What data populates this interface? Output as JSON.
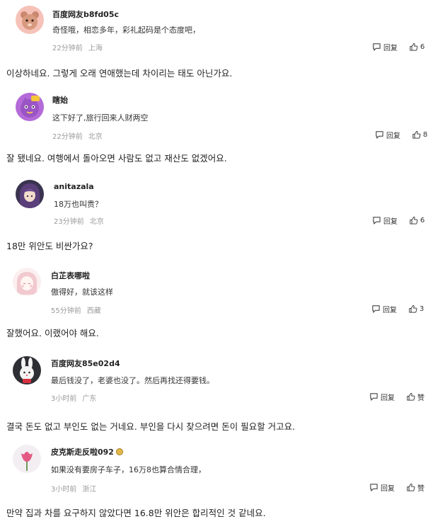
{
  "comments": [
    {
      "username": "百度网友b8fd05c",
      "text": "奇怪哦，相恋多年，彩礼起码是个态度吧，",
      "time": "22分钟前",
      "location": "上海",
      "reply_label": "回复",
      "like_count": "6",
      "avatar_icon": "cartoon-bear-avatar",
      "translation": "이상하네요. 그렇게 오래 연애했는데 차이리는 태도 아닌가요."
    },
    {
      "username": "瞎始",
      "text": "这下好了,旅行回来人财两空",
      "time": "22分钟前",
      "location": "北京",
      "reply_label": "回复",
      "like_count": "8",
      "avatar_icon": "purple-cat-avatar",
      "translation": "잘 됐네요. 여행에서 돌아오면 사람도 없고 재산도 없겠어요."
    },
    {
      "username": "anitazala",
      "text": "18万也叫贵？",
      "time": "23分钟前",
      "location": "北京",
      "reply_label": "回复",
      "like_count": "6",
      "avatar_icon": "anime-character-avatar",
      "translation": "18만 위안도 비싼가요?"
    },
    {
      "username": "白芷表哪啦",
      "text": "傲得好，就该这样",
      "time": "55分钟前",
      "location": "西藏",
      "reply_label": "回复",
      "like_count": "3",
      "avatar_icon": "pink-girl-avatar",
      "translation": "잘했어요. 이랬어야 해요."
    },
    {
      "username": "百度网友85e02d4",
      "text": "最后钱没了，老婆也没了。然后再找还得要钱。",
      "time": "3小时前",
      "location": "广东",
      "reply_label": "回复",
      "like_count": "赞",
      "avatar_icon": "white-rabbit-avatar",
      "translation": "결국 돈도 없고 부인도 없는 거네요. 부인을 다시 찾으려면 돈이 필요할 거고요."
    },
    {
      "username": "皮克斯走反啦092",
      "text": "如果没有要房子车子，16万8也算合情合理，",
      "time": "3小时前",
      "location": "浙江",
      "reply_label": "回复",
      "like_count": "赞",
      "avatar_icon": "pink-tulip-avatar",
      "badge_icon": "gold-badge-icon",
      "translation": "만약 집과 차를 요구하지 않았다면 16.8만 위안은 합리적인 것 같네요."
    }
  ],
  "icons": {
    "reply": "comment-bubble-icon",
    "like": "thumbs-up-icon"
  },
  "colors": {
    "meta_text": "#9a9a9a",
    "text": "#222222"
  }
}
